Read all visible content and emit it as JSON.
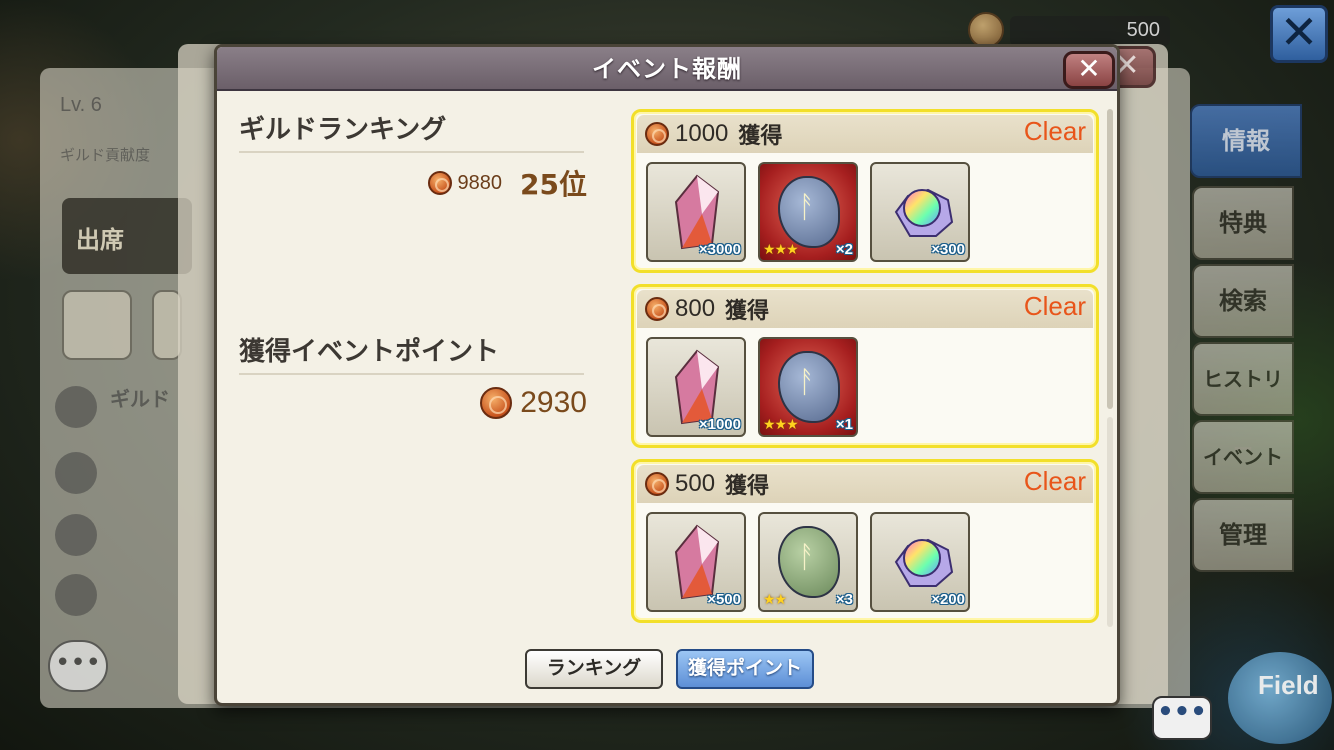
{
  "background": {
    "currency_value": "500",
    "player_level": "Lv. 6",
    "guild_contribution_label": "ギルド貢献度",
    "attend_button_label": "出席",
    "guild_label": "ギルド",
    "side_tabs": [
      {
        "label": "情報",
        "active": true
      },
      {
        "label": "特典",
        "active": false
      },
      {
        "label": "検索",
        "active": false
      },
      {
        "label": "ヒストリー",
        "active": false
      },
      {
        "label": "イベント",
        "active": false
      },
      {
        "label": "管理",
        "active": false
      }
    ],
    "field_button_label": "Field",
    "chat_bubble_label": "•••",
    "back_chat_label": "•••"
  },
  "modal": {
    "title": "イベント報酬",
    "close_label": "✕",
    "guild_ranking": {
      "label": "ギルドランキング",
      "points": "9880",
      "rank": "25位"
    },
    "earned_points": {
      "label": "獲得イベントポイント",
      "value": "2930"
    },
    "tiers": [
      {
        "amount": "1000",
        "label": "獲得",
        "status": "Clear",
        "items": [
          {
            "icon": "crystal-icon",
            "qty": "×3000",
            "stars": ""
          },
          {
            "icon": "blue-rune-stone-icon",
            "qty": "×2",
            "stars": "★★★"
          },
          {
            "icon": "rainbow-orb-icon",
            "qty": "×300",
            "stars": ""
          }
        ]
      },
      {
        "amount": "800",
        "label": "獲得",
        "status": "Clear",
        "items": [
          {
            "icon": "crystal-icon",
            "qty": "×1000",
            "stars": ""
          },
          {
            "icon": "blue-rune-stone-icon",
            "qty": "×1",
            "stars": "★★★"
          }
        ]
      },
      {
        "amount": "500",
        "label": "獲得",
        "status": "Clear",
        "items": [
          {
            "icon": "crystal-icon",
            "qty": "×500",
            "stars": ""
          },
          {
            "icon": "green-rune-stone-icon",
            "qty": "×3",
            "stars": "★★"
          },
          {
            "icon": "rainbow-orb-icon",
            "qty": "×200",
            "stars": ""
          }
        ]
      }
    ],
    "buttons": {
      "ranking": "ランキング",
      "earned_points": "獲得ポイント"
    }
  },
  "colors": {
    "clear_text": "#e8551a",
    "tier_border": "#f2df2a",
    "active_tab": "#2c5a98"
  }
}
